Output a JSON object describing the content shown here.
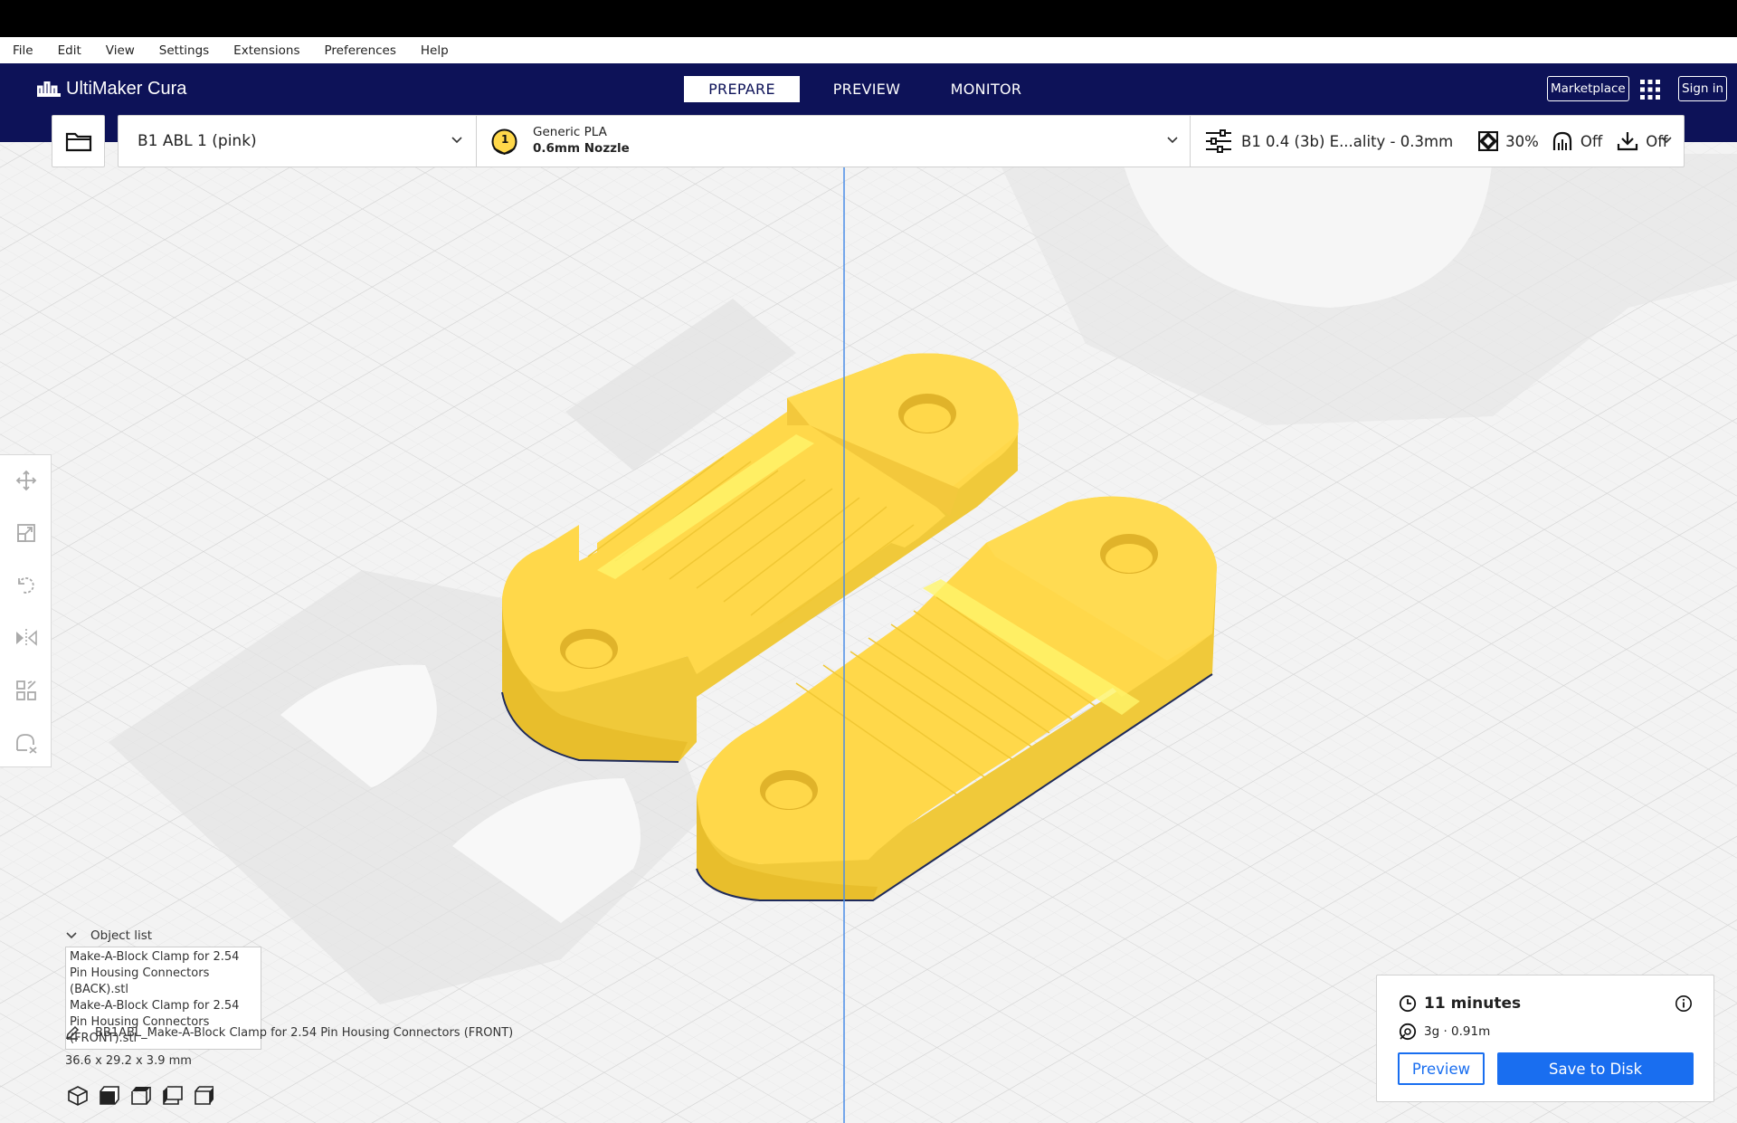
{
  "menubar": {
    "items": [
      "File",
      "Edit",
      "View",
      "Settings",
      "Extensions",
      "Preferences",
      "Help"
    ]
  },
  "header": {
    "app_name": "UltiMaker Cura",
    "stages": [
      "PREPARE",
      "PREVIEW",
      "MONITOR"
    ],
    "active_stage": "PREPARE",
    "marketplace_label": "Marketplace",
    "signin_label": "Sign in"
  },
  "printer_bar": {
    "printer_name": "B1 ABL 1 (pink)",
    "extruder_number": "1",
    "material": "Generic PLA",
    "nozzle": "0.6mm Nozzle",
    "profile": "B1 0.4 (3b) E...ality - 0.3mm",
    "infill": "30%",
    "support": "Off",
    "adhesion": "Off"
  },
  "object_list": {
    "title": "Object list",
    "items": [
      "Make-A-Block Clamp for 2.54 Pin Housing Connectors (BACK).stl",
      "Make-A-Block Clamp for 2.54 Pin Housing Connectors (FRONT).stl"
    ],
    "selected_name": "BB1ABL_Make-A-Block Clamp for 2.54 Pin Housing Connectors (FRONT)",
    "dimensions": "36.6 x 29.2 x 3.9 mm"
  },
  "action_panel": {
    "print_time": "11 minutes",
    "material_usage": "3g · 0.91m",
    "preview_label": "Preview",
    "save_label": "Save to Disk"
  },
  "colors": {
    "header_bg": "#0d1258",
    "accent": "#196ef0",
    "model_yellow": "#ffd84a",
    "build_plate": "#f3f3f3"
  },
  "icons": {
    "tools": [
      "move-icon",
      "scale-icon",
      "rotate-icon",
      "mirror-icon",
      "per-model-settings-icon",
      "support-blocker-icon"
    ],
    "views": [
      "3d-view-icon",
      "front-view-icon",
      "top-view-icon",
      "left-view-icon",
      "right-view-icon"
    ]
  }
}
